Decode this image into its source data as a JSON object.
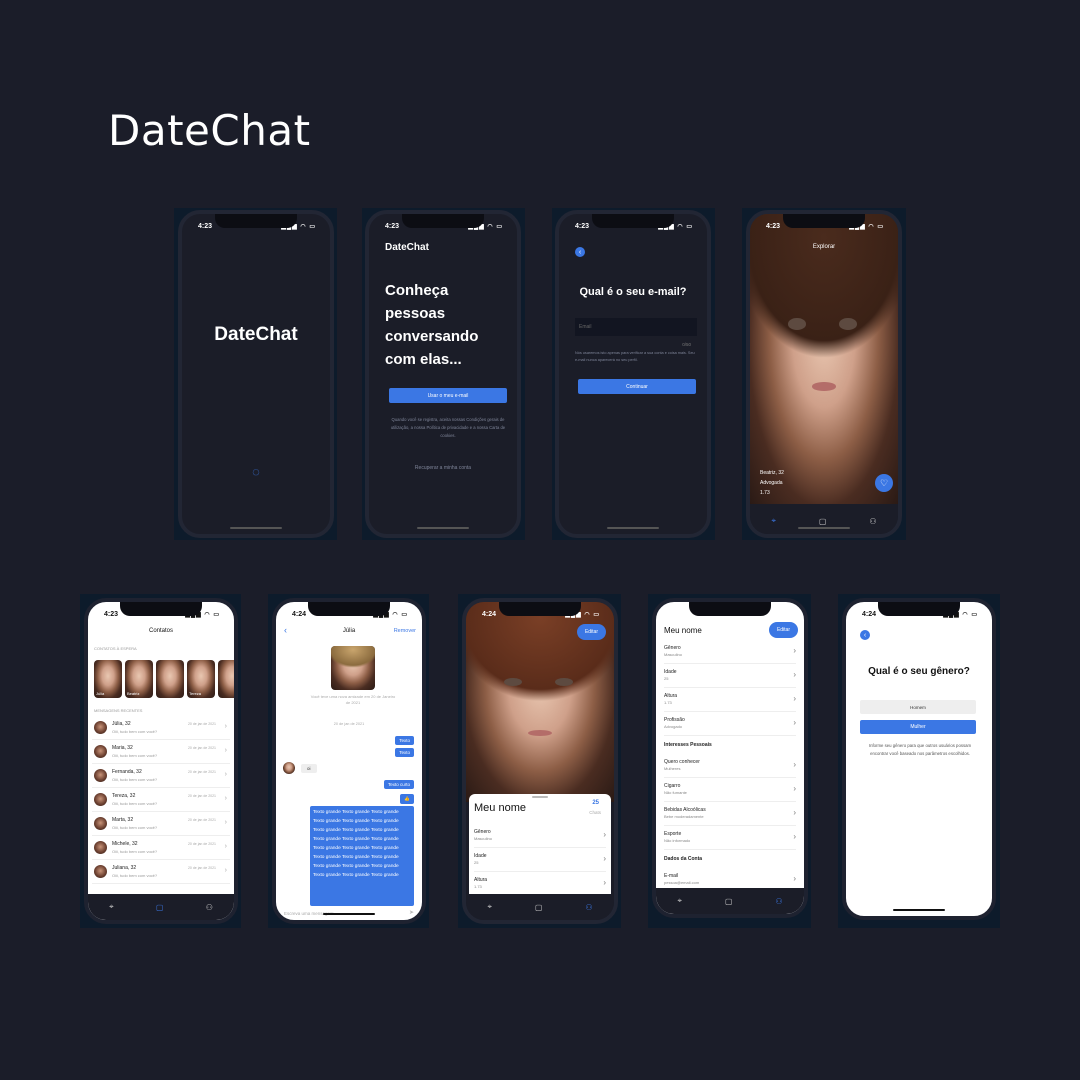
{
  "page_title": "DateChat",
  "status_time_a": "4:23",
  "status_time_b": "4:24",
  "status_icons": "▂▄▆ ◠ ▭",
  "s1": {
    "logo": "DateChat",
    "spinner": "◌"
  },
  "s2": {
    "brand": "DateChat",
    "headline_lines": [
      "Conheça",
      "pessoas",
      "conversando",
      "com elas..."
    ],
    "cta": "Usar o meu e-mail",
    "terms": "Quando você se registra, aceita nossas Condições gerais de utilização, a nossa Política de privacidade e a nossa Carta de cookies.",
    "recover": "Recuperar a minha conta"
  },
  "s3": {
    "back": "‹",
    "question": "Qual é o seu e-mail?",
    "placeholder": "Email",
    "counter": "0/50",
    "info": "Nós usaremos isto apenas para verificar a sua conta e coisa mais. Seu e-mail nunca aparecerá no seu perfil.",
    "cta": "Continuar"
  },
  "s4": {
    "header": "Explorar",
    "name": "Beatriz, 32",
    "job": "Advogada",
    "height": "1.73",
    "like_icon": "♡",
    "tabs": [
      "⌖",
      "▢",
      "⚇"
    ]
  },
  "s5": {
    "header": "Contatos",
    "stories_title": "CONTATOS À ESPERA",
    "stories": [
      "Júlia",
      "Beatriz",
      "",
      "Tereza",
      ""
    ],
    "recent_title": "MENSAGENS RECENTES",
    "contacts": [
      {
        "name": "Júlia, 32",
        "msg": "Oiii, tudo bem com você?",
        "date": "20 de jan de 2021"
      },
      {
        "name": "Maria, 32",
        "msg": "Oiii, tudo bem com você?",
        "date": "20 de jan de 2021"
      },
      {
        "name": "Fernanda, 32",
        "msg": "Oiii, tudo bem com você?",
        "date": "20 de jan de 2021"
      },
      {
        "name": "Tereza, 32",
        "msg": "Oiii, tudo bem com você?",
        "date": "20 de jan de 2021"
      },
      {
        "name": "Marta, 32",
        "msg": "Oiii, tudo bem com você?",
        "date": "20 de jan de 2021"
      },
      {
        "name": "Michele, 32",
        "msg": "Oiii, tudo bem com você?",
        "date": "20 de jan de 2021"
      },
      {
        "name": "Juliana, 32",
        "msg": "Oiii, tudo bem com você?",
        "date": "20 de jan de 2021"
      }
    ],
    "tabs": [
      "⌖",
      "▢",
      "⚇"
    ]
  },
  "s6": {
    "back": "‹",
    "name": "Júlia",
    "remove": "Remover",
    "match": "Você teve uma nova amizade em 20 de Janeiro de 2021",
    "date": "20 de jan de 2021",
    "msgs": [
      "Texto",
      "Texto",
      "Texto curto",
      "👍"
    ],
    "incoming": "oi",
    "long": "Texto grande Texto grande Texto grande Texto grande Texto grande Texto grande Texto grande Texto grande Texto grande Texto grande Texto grande Texto grande Texto grande Texto grande Texto grande Texto grande Texto grande Texto grande Texto grande Texto grande Texto grande Texto grande Texto grande Texto grande",
    "input": "Escreva uma mensagem...",
    "send": "➤"
  },
  "s7": {
    "edit": "Editar",
    "name": "Meu nome",
    "count": "25",
    "count_label": "Chats",
    "rows": [
      {
        "l": "Gênero",
        "s": "Masculino"
      },
      {
        "l": "Idade",
        "s": "25"
      },
      {
        "l": "Altura",
        "s": "1.73"
      }
    ],
    "tabs": [
      "⌖",
      "▢",
      "⚇"
    ]
  },
  "s8": {
    "name": "Meu nome",
    "edit": "Editar",
    "rows1": [
      {
        "l": "Gênero",
        "s": "Masculino"
      },
      {
        "l": "Idade",
        "s": "25"
      },
      {
        "l": "Altura",
        "s": "1.73"
      },
      {
        "l": "Profissão",
        "s": "Advogado"
      }
    ],
    "sec1": "Interesses Pessoais",
    "rows2": [
      {
        "l": "Quero conhecer",
        "s": "Mulheres"
      },
      {
        "l": "Cigarro",
        "s": "Não fumante"
      },
      {
        "l": "Bebidas Alcoólicas",
        "s": "Bebe moderadamente"
      },
      {
        "l": "Esporte",
        "s": "Não informado"
      }
    ],
    "sec2": "Dados da Conta",
    "rows3": [
      {
        "l": "E-mail",
        "s": "pessoa@email.com"
      }
    ],
    "tabs": [
      "⌖",
      "▢",
      "⚇"
    ]
  },
  "s9": {
    "back": "‹",
    "question": "Qual é o seu gênero?",
    "opt1": "Homem",
    "opt2": "Mulher",
    "info": "Informe seu gênero para que outros usuários possam encontrar você baseado nos parâmetros escolhidos."
  },
  "colors": {
    "bg": "#1b1d29",
    "accent": "#3b77e4"
  }
}
